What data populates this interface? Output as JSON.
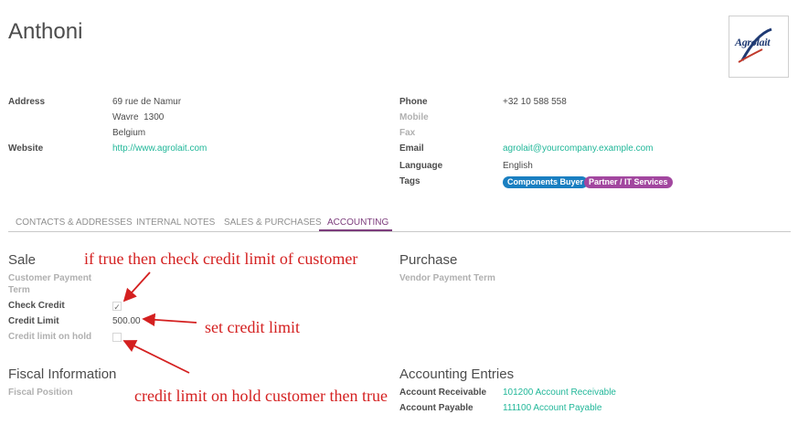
{
  "header": {
    "name": "Anthoni",
    "logo_text": "Agrolait"
  },
  "contact": {
    "address_label": "Address",
    "address_lines": [
      "69 rue de Namur",
      "Wavre  1300",
      "Belgium"
    ],
    "website_label": "Website",
    "website": "http://www.agrolait.com",
    "phone_label": "Phone",
    "phone": "+32 10 588 558",
    "mobile_label": "Mobile",
    "fax_label": "Fax",
    "email_label": "Email",
    "email": "agrolait@yourcompany.example.com",
    "language_label": "Language",
    "language": "English",
    "tags_label": "Tags",
    "tags": [
      {
        "label": "Components Buyer",
        "color": "#1a7fc1"
      },
      {
        "label": "Partner / IT Services",
        "color": "#a2479f"
      }
    ]
  },
  "tabs": [
    {
      "label": "CONTACTS & ADDRESSES"
    },
    {
      "label": "INTERNAL NOTES"
    },
    {
      "label": "SALES & PURCHASES"
    },
    {
      "label": "ACCOUNTING",
      "active": true
    }
  ],
  "sale": {
    "title": "Sale",
    "payment_term_label_1": "Customer Payment",
    "payment_term_label_2": "Term",
    "check_credit_label": "Check Credit",
    "check_credit": true,
    "credit_limit_label": "Credit Limit",
    "credit_limit": "500.00",
    "on_hold_label": "Credit limit on hold",
    "on_hold": false
  },
  "purchase": {
    "title": "Purchase",
    "vendor_term_label": "Vendor Payment Term"
  },
  "fiscal": {
    "title": "Fiscal Information",
    "position_label": "Fiscal Position"
  },
  "accounting": {
    "title": "Accounting Entries",
    "receivable_label": "Account Receivable",
    "receivable": "101200 Account Receivable",
    "payable_label": "Account Payable",
    "payable": "111100 Account Payable"
  },
  "annotations": {
    "check_credit": "if true then check credit limit of customer",
    "credit_limit": "set credit limit",
    "on_hold": "credit limit on hold customer then true",
    "color": "#d42020"
  }
}
